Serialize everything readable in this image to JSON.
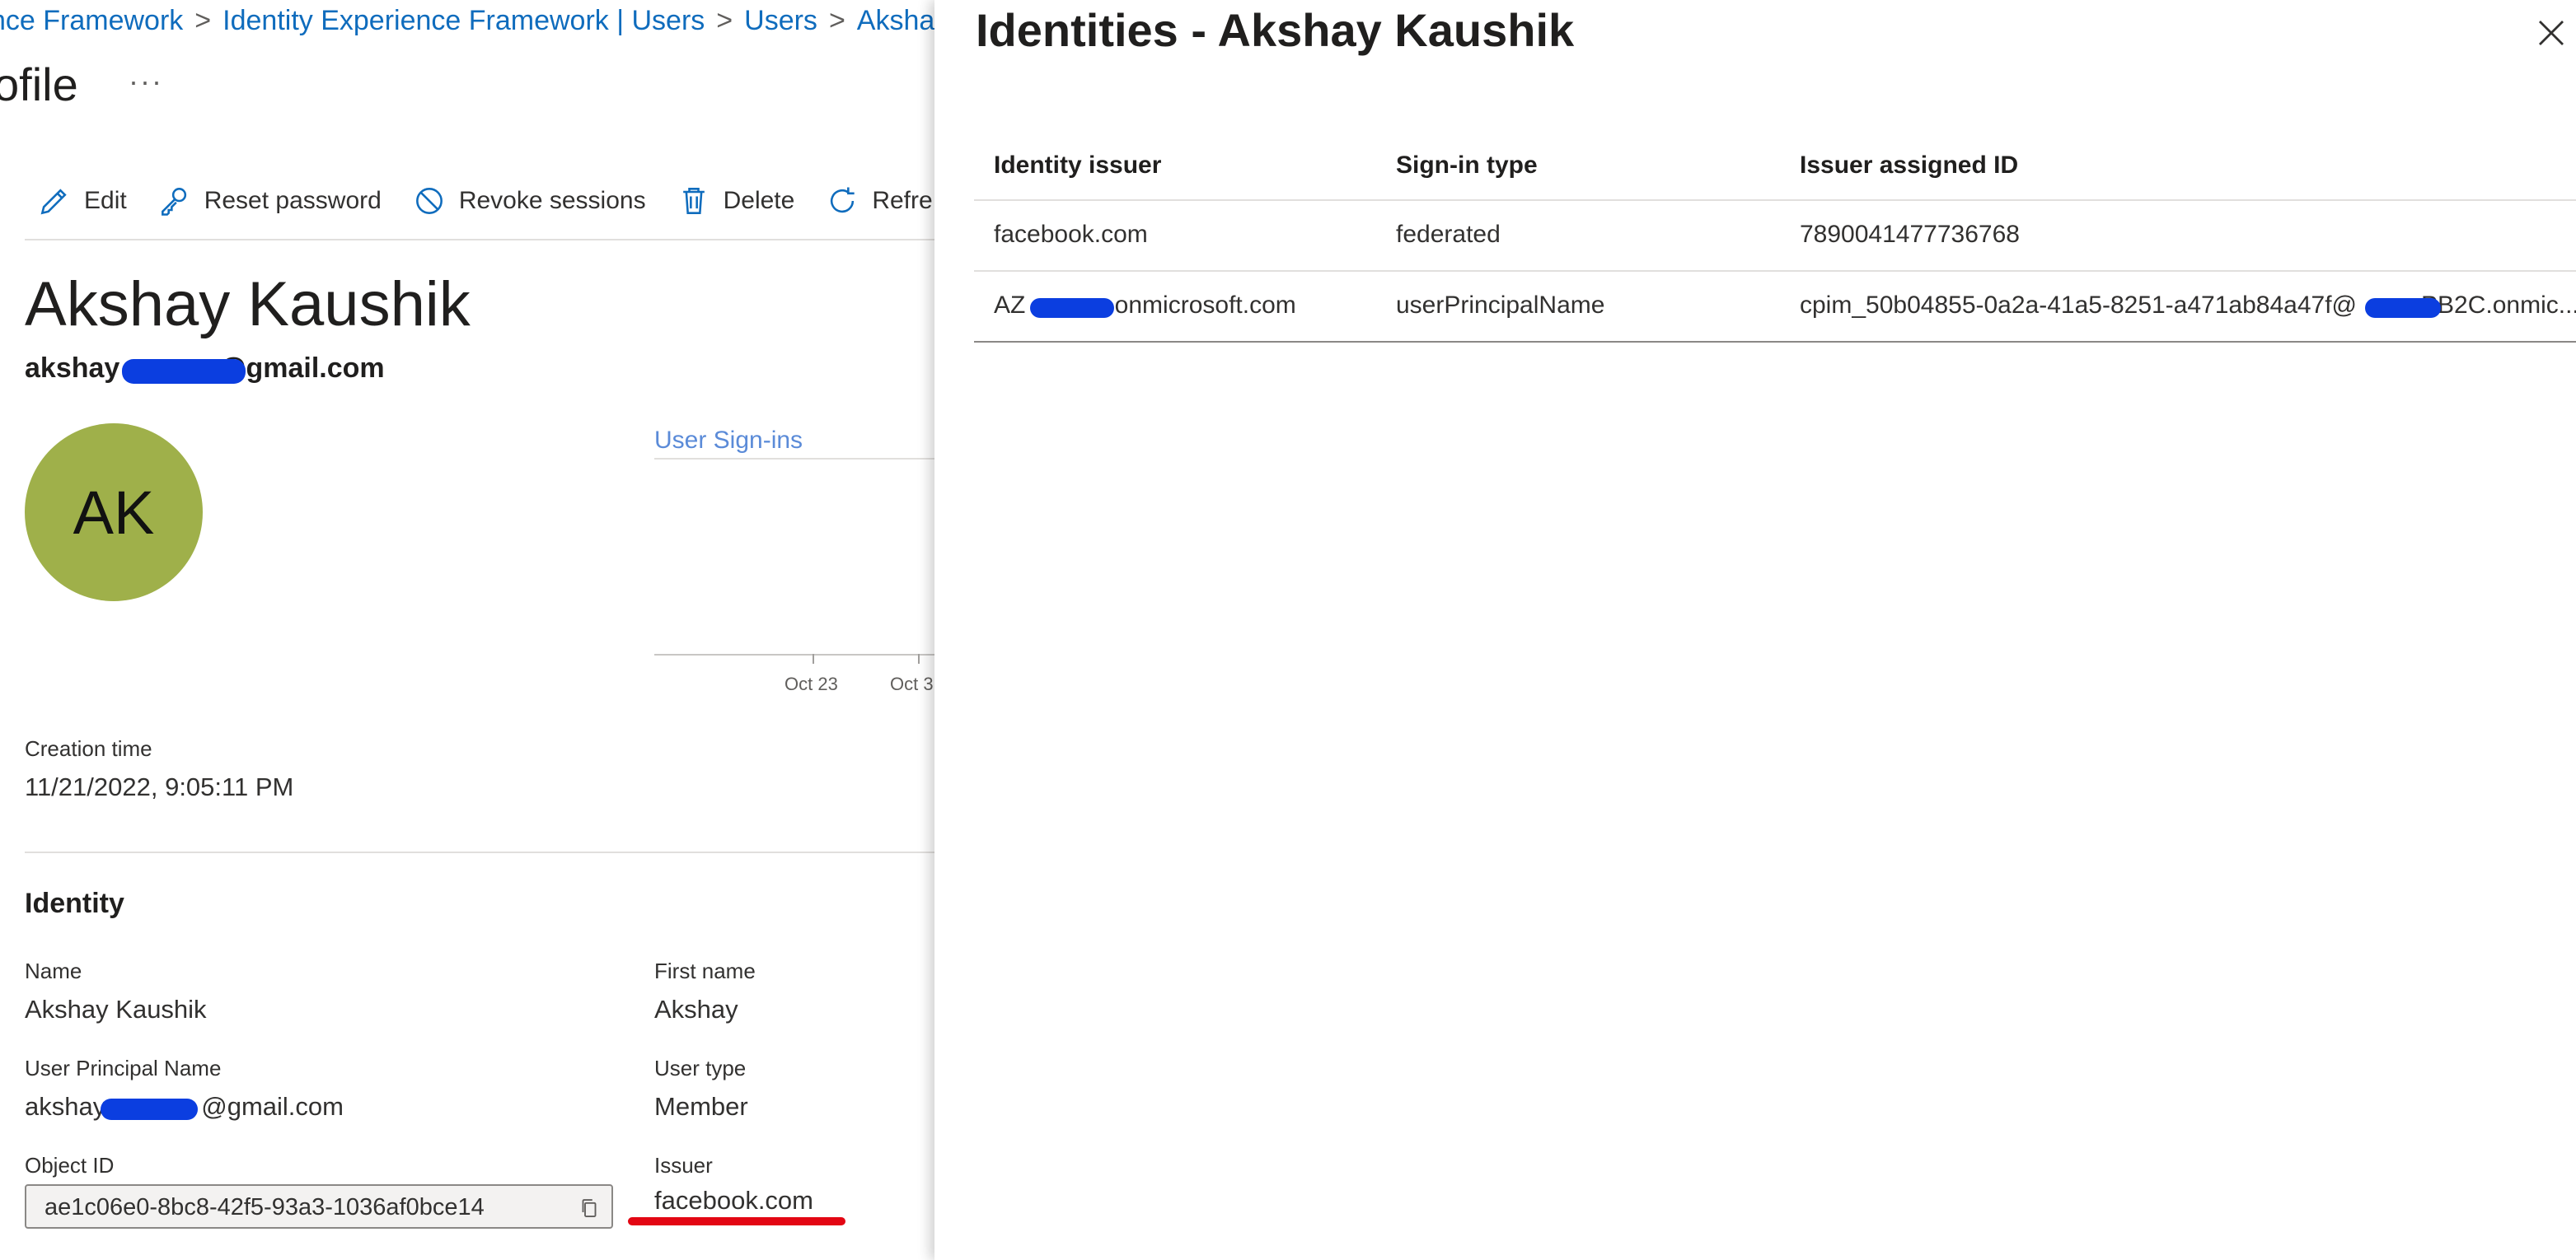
{
  "breadcrumb": {
    "items": [
      "nce Framework",
      "Identity Experience Framework | Users",
      "Users",
      "Akshay"
    ],
    "separator": ">"
  },
  "page": {
    "title": "ofile",
    "more_label": "···"
  },
  "toolbar": {
    "edit": "Edit",
    "reset_password": "Reset password",
    "revoke_sessions": "Revoke sessions",
    "delete": "Delete",
    "refresh": "Refre"
  },
  "user": {
    "display_name": "Akshay Kaushik",
    "email_prefix": "akshay",
    "email_suffix": "@gmail.com",
    "avatar_initials": "AK",
    "avatar_color": "#9fb04a"
  },
  "signins": {
    "title": "User Sign-ins",
    "ticks": [
      "Oct 23",
      "Oct 3"
    ]
  },
  "creation": {
    "label": "Creation time",
    "value": "11/21/2022, 9:05:11 PM"
  },
  "identity_section": {
    "title": "Identity",
    "name_label": "Name",
    "name_value": "Akshay Kaushik",
    "first_name_label": "First name",
    "first_name_value": "Akshay",
    "upn_label": "User Principal Name",
    "upn_prefix": "akshay",
    "upn_suffix": "@gmail.com",
    "user_type_label": "User type",
    "user_type_value": "Member",
    "object_id_label": "Object ID",
    "object_id_value": "ae1c06e0-8bc8-42f5-93a3-1036af0bce14",
    "issuer_label": "Issuer",
    "issuer_value": "facebook.com"
  },
  "panel": {
    "title": "Identities - Akshay Kaushik",
    "close_icon": "close-icon",
    "columns": [
      "Identity issuer",
      "Sign-in type",
      "Issuer assigned ID"
    ],
    "rows": [
      {
        "issuer": "facebook.com",
        "sign_in_type": "federated",
        "assigned_id": "7890041477736768"
      },
      {
        "issuer_prefix": "AZ",
        "issuer_suffix": ".onmicrosoft.com",
        "sign_in_type": "userPrincipalName",
        "assigned_id_prefix": "cpim_50b04855-0a2a-41a5-8251-a471ab84a47f@",
        "assigned_id_suffix": "PB2C.onmic..."
      }
    ]
  },
  "colors": {
    "accent": "#0f6cbd",
    "redaction": "#0b3ee0",
    "highlight": "#e30613"
  }
}
